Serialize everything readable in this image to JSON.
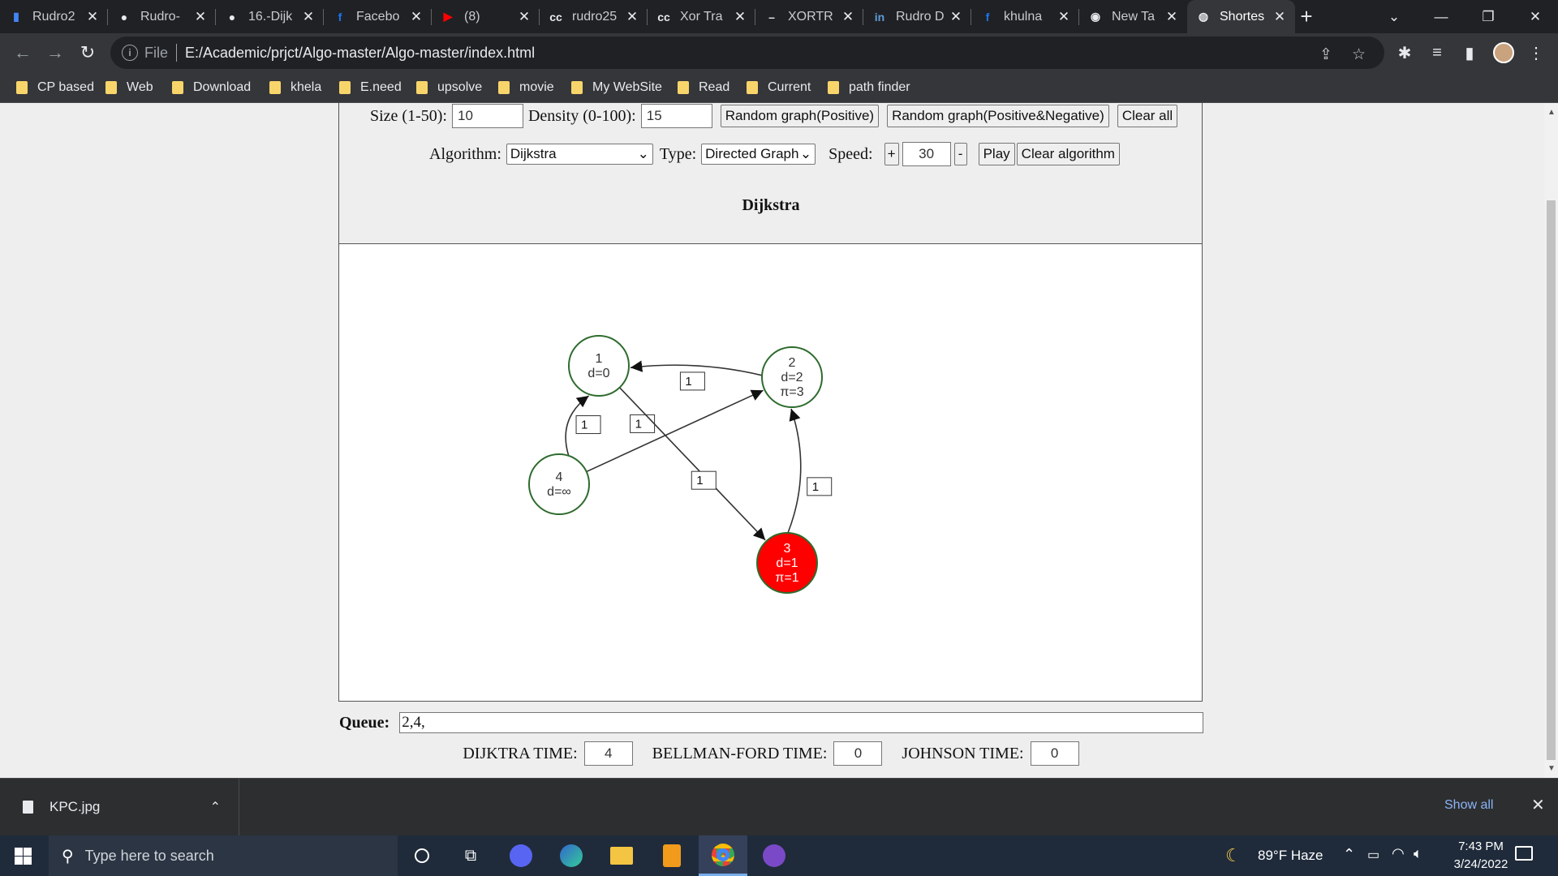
{
  "browser": {
    "tabs": [
      {
        "label": "Rudro2",
        "icon": "chart-favicon-icon"
      },
      {
        "label": "Rudro-",
        "icon": "github-favicon-icon"
      },
      {
        "label": "16.-Dijk",
        "icon": "github-favicon-icon"
      },
      {
        "label": "Facebo",
        "icon": "facebook-favicon-icon"
      },
      {
        "label": "(8)",
        "icon": "youtube-favicon-icon"
      },
      {
        "label": "rudro25",
        "icon": "codechef-favicon-icon"
      },
      {
        "label": "Xor Tra",
        "icon": "codechef-favicon-icon"
      },
      {
        "label": "XORTR",
        "icon": "generic-favicon-icon"
      },
      {
        "label": "Rudro D",
        "icon": "linkedin-favicon-icon"
      },
      {
        "label": "khulna",
        "icon": "facebook-favicon-icon"
      },
      {
        "label": "New Ta",
        "icon": "chrome-favicon-icon"
      },
      {
        "label": "Shortes",
        "icon": "globe-favicon-icon"
      }
    ],
    "url_scheme": "File",
    "url": "E:/Academic/prjct/Algo-master/Algo-master/index.html",
    "bookmarks": [
      "CP based",
      "Web",
      "Download",
      "khela",
      "E.need",
      "upsolve",
      "movie",
      "My WebSite",
      "Read",
      "Current",
      "path finder"
    ]
  },
  "controls": {
    "size_label": "Size (1-50):",
    "size_value": "10",
    "density_label": "Density (0-100):",
    "density_value": "15",
    "random_positive": "Random graph(Positive)",
    "random_mixed": "Random graph(Positive&Negative)",
    "clear_all": "Clear all",
    "algorithm_label": "Algorithm:",
    "algorithm_value": "Dijkstra",
    "type_label": "Type:",
    "type_value": "Directed Graph",
    "speed_label": "Speed:",
    "speed_plus": "+",
    "speed_value": "30",
    "speed_minus": "-",
    "play": "Play",
    "clear_algorithm": "Clear algorithm"
  },
  "algorithm_title": "Dijkstra",
  "graph": {
    "nodes": [
      {
        "id": "1",
        "lines": [
          "1",
          "d=0"
        ],
        "active": false
      },
      {
        "id": "2",
        "lines": [
          "2",
          "d=2",
          "π=3"
        ],
        "active": false
      },
      {
        "id": "3",
        "lines": [
          "3",
          "d=1",
          "π=1"
        ],
        "active": true
      },
      {
        "id": "4",
        "lines": [
          "4",
          "d=∞"
        ],
        "active": false
      }
    ],
    "edges": [
      {
        "from": "2",
        "to": "1",
        "weight": "1"
      },
      {
        "from": "4",
        "to": "1",
        "weight": "1"
      },
      {
        "from": "4",
        "to": "2",
        "weight": "1"
      },
      {
        "from": "1",
        "to": "3",
        "weight": "1"
      },
      {
        "from": "3",
        "to": "2",
        "weight": "1"
      }
    ],
    "colors": {
      "node_stroke": "#2e6b2e",
      "active_fill": "#ff0000",
      "edge": "#333333"
    }
  },
  "queue": {
    "label": "Queue:",
    "value": "2,4,"
  },
  "times": {
    "dijkstra_label": "DIJKTRA TIME:",
    "dijkstra_value": "4",
    "bellman_label": "BELLMAN-FORD TIME:",
    "bellman_value": "0",
    "johnson_label": "JOHNSON TIME:",
    "johnson_value": "0"
  },
  "download": {
    "file": "KPC.jpg",
    "show_all": "Show all"
  },
  "taskbar": {
    "search_placeholder": "Type here to search",
    "weather": "89°F Haze",
    "time": "7:43 PM",
    "date": "3/24/2022"
  }
}
